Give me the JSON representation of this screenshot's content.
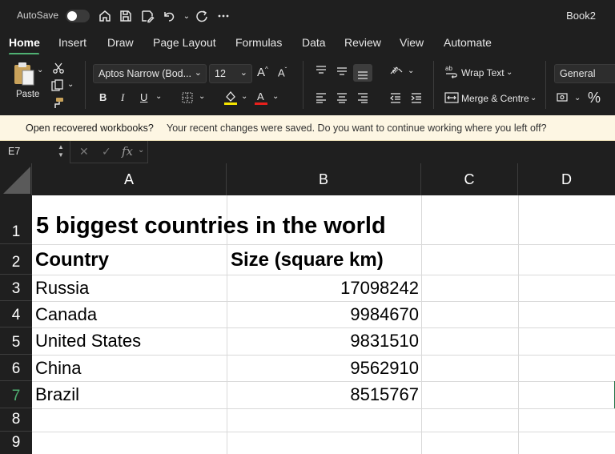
{
  "titlebar": {
    "autosave_label": "AutoSave",
    "document_title": "Book2"
  },
  "ribbon_tabs": [
    "Home",
    "Insert",
    "Draw",
    "Page Layout",
    "Formulas",
    "Data",
    "Review",
    "View",
    "Automate"
  ],
  "ribbon": {
    "paste_label": "Paste",
    "font_name": "Aptos Narrow (Bod...",
    "font_size": "12",
    "wrap_text_label": "Wrap Text",
    "merge_label": "Merge & Centre",
    "number_format": "General",
    "bold": "B",
    "italic": "I",
    "underline": "U"
  },
  "message_bar": {
    "title": "Open recovered workbooks?",
    "text": "Your recent changes were saved. Do you want to continue working where you left off?"
  },
  "formula_bar": {
    "name_box": "E7",
    "fx_label": "fx",
    "formula": ""
  },
  "columns": [
    "A",
    "B",
    "C",
    "D"
  ],
  "rows": [
    "1",
    "2",
    "3",
    "4",
    "5",
    "6",
    "7",
    "8",
    "9"
  ],
  "sheet": {
    "title": "5 biggest countries in the world",
    "header_country": "Country",
    "header_size": "Size (square km)",
    "data": [
      {
        "country": "Russia",
        "size": "17098242"
      },
      {
        "country": "Canada",
        "size": "9984670"
      },
      {
        "country": "United States",
        "size": "9831510"
      },
      {
        "country": "China",
        "size": "9562910"
      },
      {
        "country": "Brazil",
        "size": "8515767"
      }
    ]
  },
  "colors": {
    "chrome": "#1f1f1f",
    "accent": "#4fb072",
    "message_bar": "#fdf6e3"
  }
}
